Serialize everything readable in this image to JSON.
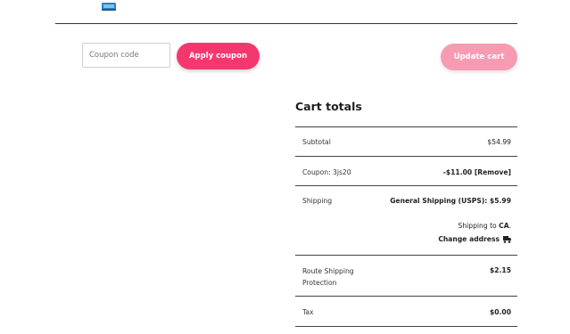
{
  "coupon": {
    "placeholder": "Coupon code",
    "value": ""
  },
  "buttons": {
    "apply_coupon": "Apply coupon",
    "update_cart": "Update cart"
  },
  "cart_totals": {
    "title": "Cart totals",
    "subtotal": {
      "label": "Subtotal",
      "value": "$54.99"
    },
    "coupon_row": {
      "label": "Coupon: 3js20",
      "value": "-$11.00",
      "remove": "[Remove]"
    },
    "shipping": {
      "label": "Shipping",
      "method": "General Shipping (USPS): $5.99",
      "ship_to_prefix": "Shipping to",
      "ship_to_location": "CA",
      "change_address": "Change address"
    },
    "route": {
      "label": "Route Shipping Protection",
      "value": "$2.15"
    },
    "tax": {
      "label": "Tax",
      "value": "$0.00"
    }
  },
  "colors": {
    "primary": "#f4386f",
    "primary_disabled": "#f79bb3",
    "divider": "#444444"
  },
  "icons": {
    "product_thumbnail": "product-thumbnail-icon",
    "change_address": "truck-icon"
  }
}
